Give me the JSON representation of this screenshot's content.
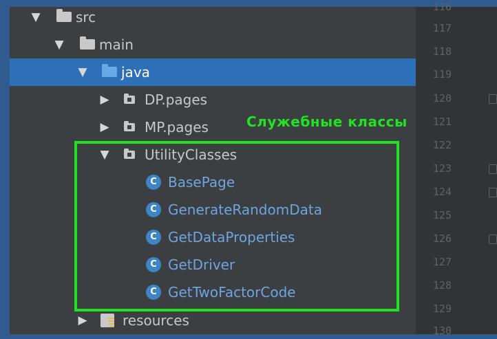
{
  "tree": {
    "items": [
      {
        "label": "src",
        "arrow": "▼"
      },
      {
        "label": "main",
        "arrow": "▼"
      },
      {
        "label": "java",
        "arrow": "▼"
      },
      {
        "label": "DP.pages",
        "arrow": "▶"
      },
      {
        "label": "MP.pages",
        "arrow": "▶"
      },
      {
        "label": "UtilityClasses",
        "arrow": "▼"
      },
      {
        "label": "BasePage",
        "icon_letter": "C"
      },
      {
        "label": "GenerateRandomData",
        "icon_letter": "C"
      },
      {
        "label": "GetDataProperties",
        "icon_letter": "C"
      },
      {
        "label": "GetDriver",
        "icon_letter": "C"
      },
      {
        "label": "GetTwoFactorCode",
        "icon_letter": "C"
      },
      {
        "label": "resources",
        "arrow": "▶"
      }
    ]
  },
  "gutter": {
    "line_numbers": [
      "116",
      "117",
      "118",
      "119",
      "120",
      "121",
      "122",
      "123",
      "124",
      "125",
      "126",
      "127",
      "128",
      "129",
      "130"
    ]
  },
  "annotation": {
    "text": "Служебные классы",
    "color": "#22e322"
  },
  "colors": {
    "selection": "#2e70b8",
    "class_text": "#6ea5e0",
    "frame": "#2f5b8e"
  }
}
